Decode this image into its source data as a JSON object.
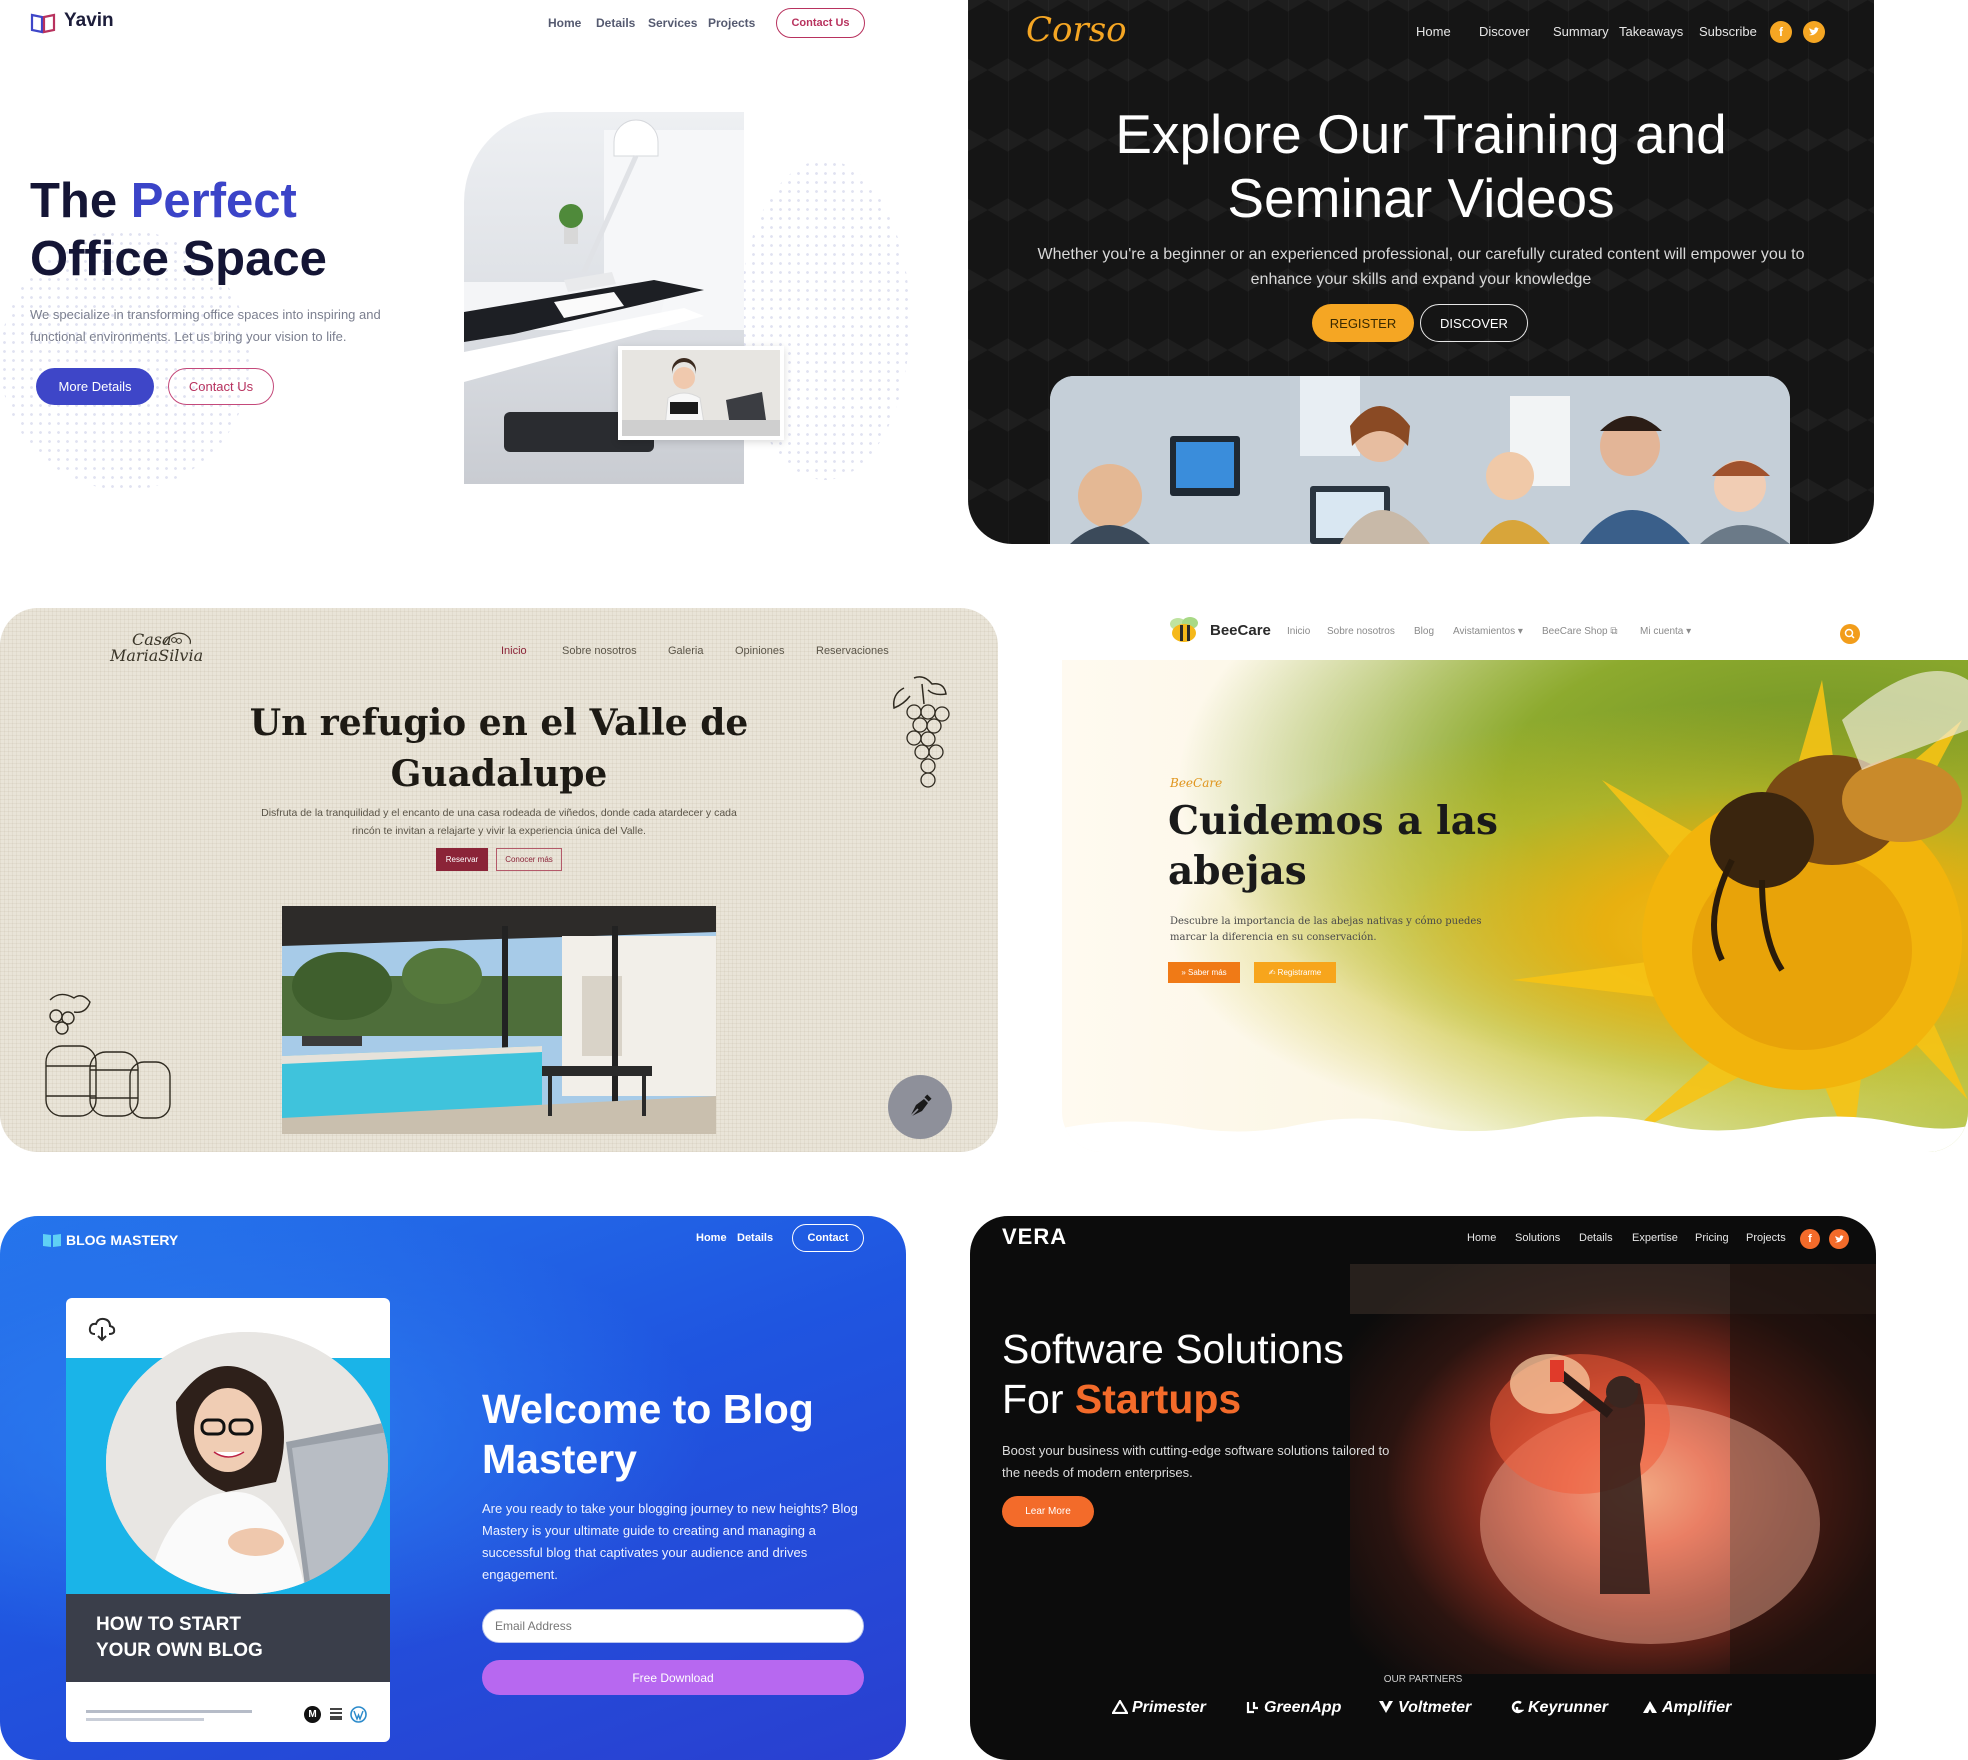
{
  "yavin": {
    "logo": "Yavin",
    "nav": [
      "Home",
      "Details",
      "Services",
      "Projects"
    ],
    "nav_cta": "Contact Us",
    "title_line1_plain": "The ",
    "title_line1_accent": "Perfect",
    "title_line2": "Office Space",
    "description": "We specialize in transforming office spaces into inspiring and functional environments. Let us bring your vision to life.",
    "primary_button": "More Details",
    "secondary_button": "Contact Us",
    "accent_color": "#3e46c8"
  },
  "corso": {
    "logo": "Corso",
    "nav": [
      "Home",
      "Discover",
      "Summary",
      "Takeaways",
      "Subscribe"
    ],
    "social_icons": [
      "facebook-icon",
      "twitter-icon"
    ],
    "title_line1": "Explore Our Training and",
    "title_line2": "Seminar Videos",
    "description": "Whether you're a beginner or an experienced professional, our carefully curated content will empower you to enhance your skills and expand your knowledge",
    "primary_button": "REGISTER",
    "secondary_button": "DISCOVER",
    "accent_color": "#f5a623"
  },
  "casa": {
    "logo_line1": "Casa",
    "logo_line2": "MariaSilvia",
    "nav": [
      "Inicio",
      "Sobre nosotros",
      "Galeria",
      "Opiniones",
      "Reservaciones"
    ],
    "active_nav": "Inicio",
    "title_line1": "Un refugio en el Valle de",
    "title_line2": "Guadalupe",
    "description": "Disfruta de la tranquilidad y el encanto de una casa rodeada de viñedos, donde cada atardecer y cada rincón te invitan a relajarte y vivir la experiencia única del Valle.",
    "primary_button": "Reservar",
    "secondary_button": "Conocer más",
    "accent_color": "#8b2438"
  },
  "beecare": {
    "logo": "BeeCare",
    "nav": [
      "Inicio",
      "Sobre nosotros",
      "Blog",
      "Avistamientos ▾",
      "BeeCare Shop ⧉",
      "Mi cuenta ▾"
    ],
    "tag": "BeeCare",
    "title_line1": "Cuidemos a las",
    "title_line2": "abejas",
    "description": "Descubre la importancia de las abejas nativas y cómo puedes marcar la diferencia en su conservación.",
    "primary_button": "» Saber más",
    "secondary_button": "✍ Registrarme",
    "accent_color": "#f07a16"
  },
  "blog": {
    "logo": "BLOG MASTERY",
    "nav": [
      "Home",
      "Details"
    ],
    "nav_cta": "Contact",
    "card_title_line1": "HOW TO START",
    "card_title_line2": "YOUR OWN BLOG",
    "title_line1": "Welcome to Blog",
    "title_line2": "Mastery",
    "description": "Are you ready to take your blogging journey to new heights? Blog Mastery is your ultimate guide to creating and managing a successful blog that captivates your audience and drives engagement.",
    "email_placeholder": "Email Address",
    "download_button": "Free Download",
    "accent_color": "#b768f0"
  },
  "vera": {
    "logo": "VERA",
    "nav": [
      "Home",
      "Solutions",
      "Details",
      "Expertise",
      "Pricing",
      "Projects"
    ],
    "social_icons": [
      "facebook-icon",
      "twitter-icon"
    ],
    "title_line1": "Software Solutions",
    "title_line2_plain": "For ",
    "title_line2_accent": "Startups",
    "description": "Boost your business with cutting-edge software solutions tailored to the needs of modern enterprises.",
    "button": "Lear More",
    "partners_label": "OUR PARTNERS",
    "partners": [
      "Primester",
      "GreenApp",
      "Voltmeter",
      "Keyrunner",
      "Amplifier"
    ],
    "accent_color": "#f36b2a"
  }
}
